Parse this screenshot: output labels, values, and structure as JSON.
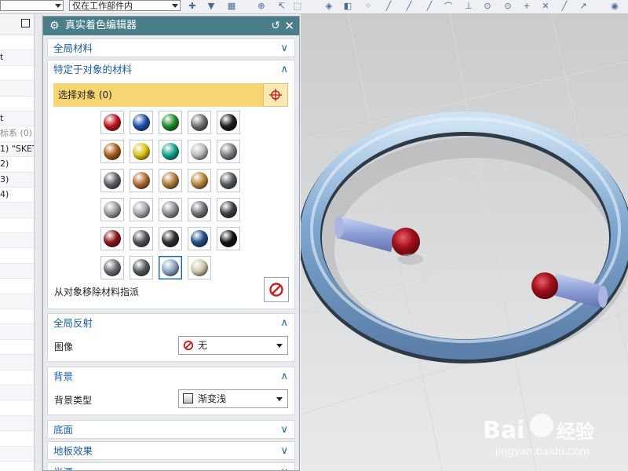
{
  "toolbar": {
    "combo_left_value": "",
    "combo_filter_value": "仅在工作部件内"
  },
  "navigator": {
    "rows": [
      "",
      "t",
      "",
      "",
      "",
      "t",
      "标系 (0)",
      "1) \"SKET",
      "2)",
      "3)",
      "4)",
      "",
      "",
      "",
      "",
      "",
      "",
      "",
      "",
      "",
      "",
      "",
      "",
      "",
      "",
      "",
      "",
      "",
      ""
    ]
  },
  "dialog": {
    "title": "真实着色编辑器",
    "sections": {
      "global_materials": "全局材料",
      "object_materials": "特定于对象的材料",
      "global_reflection": "全局反射",
      "background": "背景",
      "floor": "底面",
      "floor_effects": "地板效果",
      "lights": "光源"
    },
    "select_object_label": "选择对象 (0)",
    "remove_material_label": "从对象移除材料指派",
    "image_label": "图像",
    "image_value": "无",
    "background_type_label": "背景类型",
    "background_type_value": "渐变浅"
  },
  "materials": [
    [
      "#c0141a",
      "#1a4fb0",
      "#1f8a2a",
      "#6e6e6e",
      "#1b1b1b"
    ],
    [
      "#a85b1a",
      "#d8c214",
      "#12a090",
      "#b9b9b9",
      "#7b7f85"
    ],
    [
      "#5d6168",
      "#b06a32",
      "#b07b3a",
      "#b8863a",
      "#565a60"
    ],
    [
      "#9a9ca1",
      "#a7a9ad",
      "#8d9096",
      "#6e7278",
      "#3c4046"
    ],
    [
      "#8e1218",
      "#4e5258",
      "#2a2c30",
      "#1f4d86",
      "#111111"
    ],
    [
      "#6a6e74",
      "#55595f",
      "#8ea3c3",
      "#cfc5a8"
    ]
  ],
  "watermark": {
    "brand": "Bai",
    "brand2": "经验",
    "url": "jingyan.baidu.com"
  },
  "colors": {
    "title_bar": "#4a7f8a",
    "section_link": "#1a5fa8",
    "selection_yellow": "#f7d572"
  }
}
